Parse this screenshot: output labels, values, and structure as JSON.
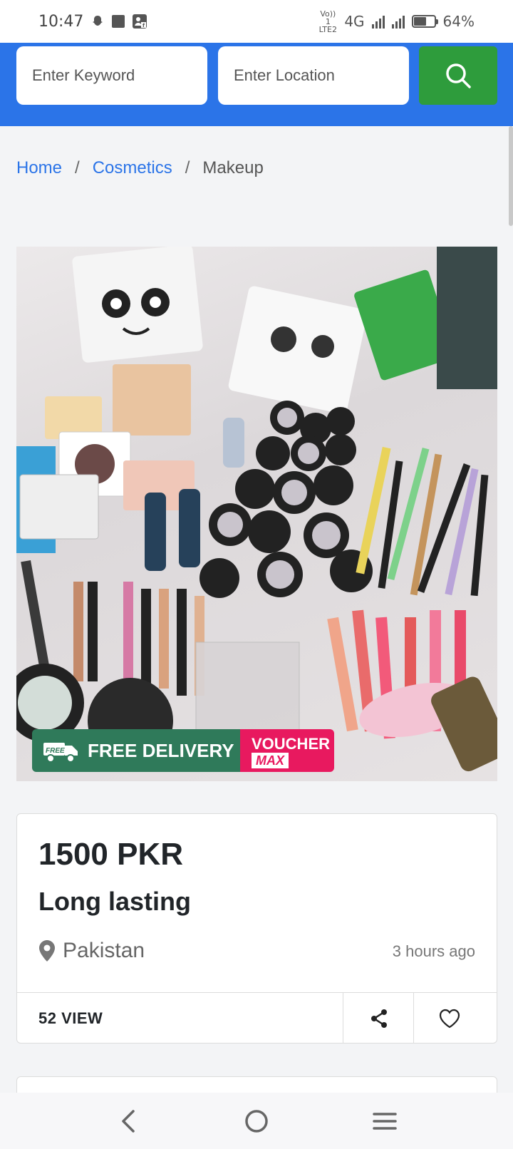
{
  "status_bar": {
    "time": "10:47",
    "network_label": "Vo)) 1 LTE2",
    "network_type": "4G",
    "battery_percent": "64%",
    "battery_level": 0.64
  },
  "search": {
    "keyword_placeholder": "Enter Keyword",
    "location_placeholder": "Enter Location",
    "button_icon": "search-icon"
  },
  "breadcrumb": {
    "items": [
      {
        "label": "Home",
        "link": true
      },
      {
        "label": "Cosmetics",
        "link": true
      },
      {
        "label": "Makeup",
        "link": false
      }
    ],
    "separator": "/"
  },
  "product_image": {
    "badge_delivery": "FREE DELIVERY",
    "badge_free_tag": "FREE",
    "badge_voucher": "VOUCHER",
    "badge_voucher_max": "MAX",
    "colors": {
      "delivery": "#2f7a5a",
      "voucher": "#e8195f"
    }
  },
  "listing": {
    "price": "1500 PKR",
    "title": "Long lasting",
    "location": "Pakistan",
    "posted": "3 hours ago",
    "views": "52 VIEW"
  },
  "colors": {
    "primary": "#2b74e8",
    "search_button": "#2e9c3c"
  },
  "nav": {
    "back_icon": "back-icon",
    "home_icon": "home-icon",
    "menu_icon": "menu-icon"
  }
}
